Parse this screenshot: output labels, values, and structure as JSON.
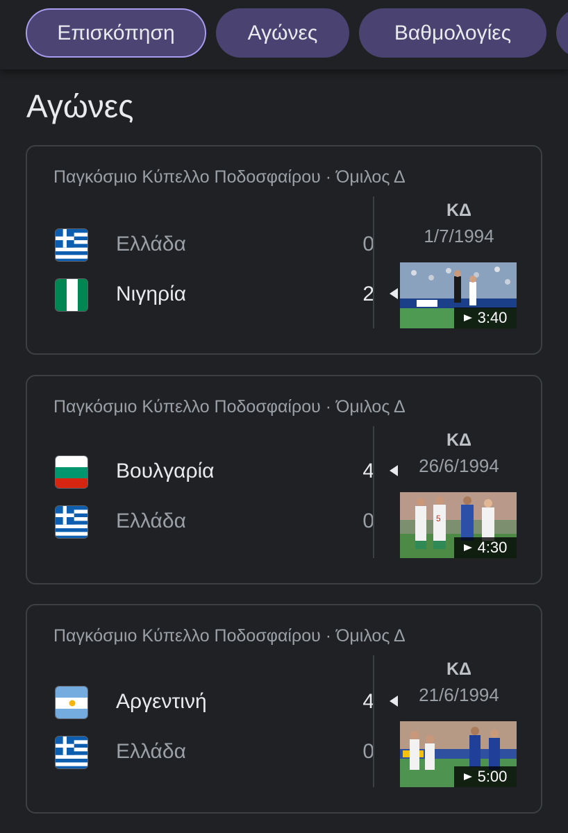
{
  "tabs": [
    {
      "label": "Επισκόπηση",
      "active": true
    },
    {
      "label": "Αγώνες"
    },
    {
      "label": "Βαθμολογίες"
    }
  ],
  "section_title": "Αγώνες",
  "matches": [
    {
      "competition": "Παγκόσμιο Κύπελλο Ποδοσφαίρου · Όμιλος Δ",
      "status": "ΚΔ",
      "date": "1/7/1994",
      "duration": "3:40",
      "teams": [
        {
          "name": "Ελλάδα",
          "score": "0",
          "flag": "greece-flag"
        },
        {
          "name": "Νιγηρία",
          "score": "2",
          "flag": "nigeria-flag"
        }
      ]
    },
    {
      "competition": "Παγκόσμιο Κύπελλο Ποδοσφαίρου · Όμιλος Δ",
      "status": "ΚΔ",
      "date": "26/6/1994",
      "duration": "4:30",
      "teams": [
        {
          "name": "Βουλγαρία",
          "score": "4",
          "flag": "bulgaria-flag"
        },
        {
          "name": "Ελλάδα",
          "score": "0",
          "flag": "greece-flag"
        }
      ]
    },
    {
      "competition": "Παγκόσμιο Κύπελλο Ποδοσφαίρου · Όμιλος Δ",
      "status": "ΚΔ",
      "date": "21/6/1994",
      "duration": "5:00",
      "teams": [
        {
          "name": "Αργεντινή",
          "score": "4",
          "flag": "argentina-flag"
        },
        {
          "name": "Ελλάδα",
          "score": "0",
          "flag": "greece-flag"
        }
      ]
    }
  ],
  "colors": {
    "tab_bg": "#4a4270",
    "tab_active_border": "#a89bf0",
    "background": "#202124"
  }
}
